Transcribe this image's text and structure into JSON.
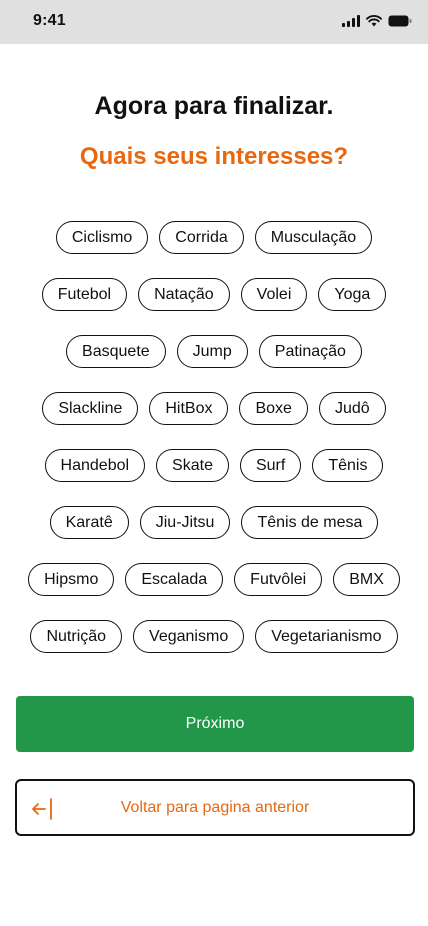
{
  "status_bar": {
    "time": "9:41"
  },
  "header": {
    "title": "Agora para finalizar.",
    "subtitle": "Quais seus interesses?"
  },
  "interests": {
    "rows": [
      [
        "Ciclismo",
        "Corrida",
        "Musculação"
      ],
      [
        "Futebol",
        "Natação",
        "Volei",
        "Yoga"
      ],
      [
        "Basquete",
        "Jump",
        "Patinação"
      ],
      [
        "Slackline",
        "HitBox",
        "Boxe",
        "Judô"
      ],
      [
        "Handebol",
        "Skate",
        "Surf",
        "Tênis"
      ],
      [
        "Karatê",
        "Jiu-Jitsu",
        "Tênis de mesa"
      ],
      [
        "Hipsmo",
        "Escalada",
        "Futvôlei",
        "BMX"
      ],
      [
        "Nutrição",
        "Veganismo",
        "Vegetarianismo"
      ]
    ]
  },
  "actions": {
    "next_label": "Próximo",
    "back_label": "Voltar para pagina anterior"
  },
  "colors": {
    "accent": "#e8680f",
    "primary_button": "#22974a",
    "status_bar": "#e0e0e0"
  },
  "icons": {
    "signal": "cellular-signal-icon",
    "wifi": "wifi-icon",
    "battery": "battery-icon",
    "back": "arrow-left-icon"
  }
}
